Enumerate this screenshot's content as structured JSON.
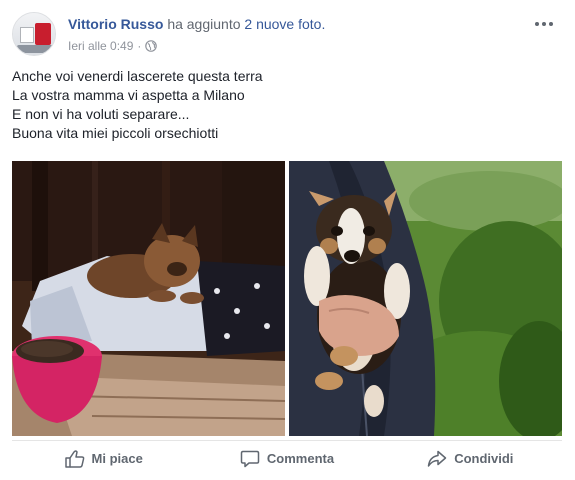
{
  "post": {
    "author": "Vittorio Russo",
    "action_text": "ha aggiunto",
    "photos_link": "2 nuove foto.",
    "timestamp": "Ieri alle 0:49",
    "separator": "·",
    "privacy_icon": "globe-icon",
    "more_icon": "more-options-icon",
    "text_lines": [
      "Anche voi venerdi lascerete questa terra",
      "La vostra mamma vi aspetta a Milano",
      "E non vi ha voluti separare...",
      "Buona vita miei piccoli orsechiotti"
    ]
  },
  "actions": {
    "like": {
      "label": "Mi piace",
      "icon": "thumbs-up-icon"
    },
    "comment": {
      "label": "Commenta",
      "icon": "comment-icon"
    },
    "share": {
      "label": "Condividi",
      "icon": "share-icon"
    }
  },
  "colors": {
    "link": "#365899",
    "meta": "#90949c",
    "text": "#1d2129",
    "action": "#606770"
  }
}
